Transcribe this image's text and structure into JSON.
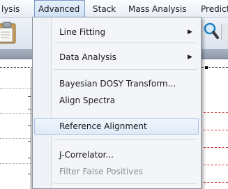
{
  "menubar": {
    "items": [
      {
        "label": "lysis"
      },
      {
        "label": "Advanced"
      },
      {
        "label": "Stack"
      },
      {
        "label": "Mass Analysis"
      },
      {
        "label": "Predict"
      }
    ]
  },
  "toolbar": {
    "icons": [
      "clipboard-icon",
      "magnifier-icon"
    ]
  },
  "advanced_menu": {
    "items": [
      {
        "label": "Line Fitting",
        "has_submenu": true,
        "enabled": true
      },
      {
        "label": "Data Analysis",
        "has_submenu": true,
        "enabled": true
      },
      {
        "label": "Bayesian DOSY Transform...",
        "enabled": true
      },
      {
        "label": "Align Spectra",
        "enabled": true
      },
      {
        "label": "Reference Alignment",
        "enabled": true,
        "highlighted": true
      },
      {
        "label": "J-Correlator...",
        "enabled": true
      },
      {
        "label": "Filter False Positives",
        "enabled": false
      }
    ],
    "submenu_arrow": "▶"
  },
  "colors": {
    "menu_bg": "#f3f5f8",
    "highlight_bg": "#dfeaf8",
    "highlight_border": "#a9c4e8",
    "disabled_text": "#8c9096"
  }
}
